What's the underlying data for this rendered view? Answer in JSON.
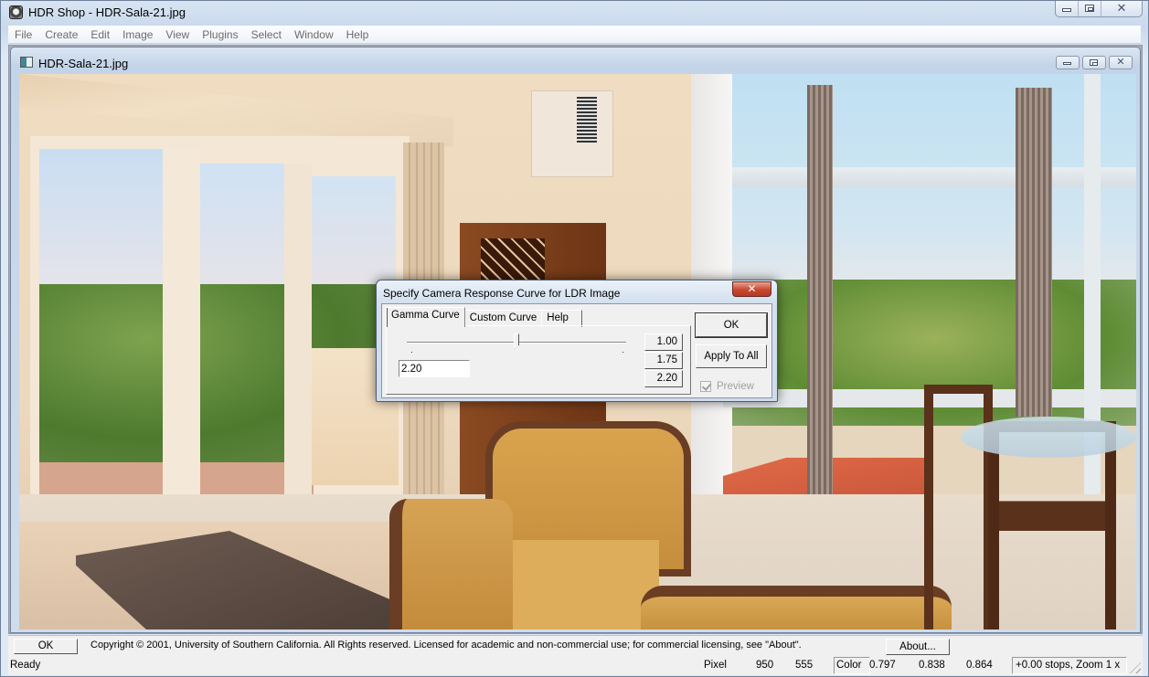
{
  "app": {
    "title": "HDR Shop - HDR-Sala-21.jpg",
    "icon": "hdr-shop-app-icon",
    "caption_buttons": [
      "minimize",
      "maximize",
      "close"
    ]
  },
  "menubar": {
    "items": [
      "File",
      "Create",
      "Edit",
      "Image",
      "View",
      "Plugins",
      "Select",
      "Window",
      "Help"
    ]
  },
  "document_window": {
    "title": "HDR-Sala-21.jpg",
    "icon": "image-document-icon",
    "caption_buttons": [
      "minimize",
      "maximize",
      "close"
    ],
    "image_description": "Living room interior with sliding glass doors, bay windows, armchair, coffee table and wooden dining chairs"
  },
  "dialog": {
    "title": "Specify Camera Response Curve for LDR Image",
    "close_glyph": "✕",
    "tabs": [
      {
        "label": "Gamma Curve",
        "active": true
      },
      {
        "label": "Custom Curve",
        "active": false
      },
      {
        "label": "Help",
        "active": false
      }
    ],
    "gamma_slider": {
      "min": 1.0,
      "max": 3.4,
      "value": 2.2
    },
    "gamma_value": "2.20",
    "presets": [
      "1.00",
      "1.75",
      "2.20"
    ],
    "ok_label": "OK",
    "apply_all_label": "Apply To All",
    "preview_label": "Preview",
    "preview_checked": true,
    "preview_enabled": false
  },
  "infobar": {
    "ok_label": "OK",
    "copyright": "Copyright © 2001, University of Southern California.  All Rights reserved.  Licensed for academic and non-commercial use; for commercial licensing, see \"About\".",
    "about_label": "About..."
  },
  "statusbar": {
    "status": "Ready",
    "pixel_label": "Pixel",
    "pixel_x": "950",
    "pixel_y": "555",
    "color_label": "Color",
    "color_r": "0.797",
    "color_g": "0.838",
    "color_b": "0.864",
    "exposure_zoom": "+0.00 stops, Zoom 1 x"
  }
}
